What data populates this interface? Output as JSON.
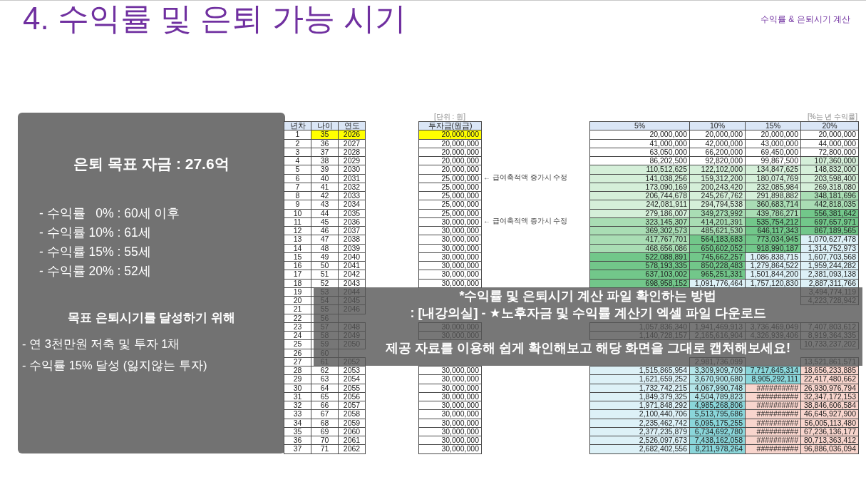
{
  "header": {
    "title": "4. 수익률 및 은퇴 가능 시기",
    "section": "수익률 & 은퇴시기 계산"
  },
  "summary": {
    "heading": "은퇴 목표 자금 : 27.6억",
    "results": [
      "- 수익률   0% : 60세 이후",
      "- 수익률 10% : 61세",
      "- 수익률 15% : 55세",
      "- 수익률 20% : 52세"
    ],
    "plan_heading": "목표 은퇴시기를 달성하기 위해",
    "plan": [
      "- 연 3천만원 저축 및 투자 1채",
      "- 수익률 15% 달성 (잃지않는 투자)"
    ]
  },
  "sheet": {
    "unit_note": "[단위 : 원]",
    "rate_note": "[%는 년 수익률]",
    "columns": [
      "년차",
      "나이",
      "연도"
    ],
    "invest_column": "투자금(원금)",
    "rate_columns": [
      "5%",
      "10%",
      "15%",
      "20%"
    ],
    "rows": [
      {
        "cells": [
          "1",
          "35",
          "2026"
        ],
        "invest": "20,000,000",
        "highlighted": true
      },
      {
        "cells": [
          "2",
          "36",
          "2027"
        ],
        "invest": "20,000,000",
        "highlighted": false
      },
      {
        "cells": [
          "3",
          "37",
          "2028"
        ],
        "invest": "20,000,000",
        "highlighted": false
      },
      {
        "cells": [
          "4",
          "38",
          "2029"
        ],
        "invest": "20,000,000",
        "highlighted": false
      },
      {
        "cells": [
          "5",
          "39",
          "2030"
        ],
        "invest": "20,000,000",
        "highlighted": false
      },
      {
        "cells": [
          "6",
          "40",
          "2031"
        ],
        "invest": "25,000,000",
        "highlighted": false,
        "note": "← 급여축적액 증가시 수정"
      },
      {
        "cells": [
          "7",
          "41",
          "2032"
        ],
        "invest": "25,000,000",
        "highlighted": false
      },
      {
        "cells": [
          "8",
          "42",
          "2033"
        ],
        "invest": "25,000,000",
        "highlighted": false
      },
      {
        "cells": [
          "9",
          "43",
          "2034"
        ],
        "invest": "25,000,000",
        "highlighted": false
      },
      {
        "cells": [
          "10",
          "44",
          "2035"
        ],
        "invest": "25,000,000",
        "highlighted": false
      },
      {
        "cells": [
          "11",
          "45",
          "2036"
        ],
        "invest": "30,000,000",
        "highlighted": false,
        "note": "← 급여축적액 증가시 수정"
      },
      {
        "cells": [
          "12",
          "46",
          "2037"
        ],
        "invest": "30,000,000",
        "highlighted": false
      },
      {
        "cells": [
          "13",
          "47",
          "2038"
        ],
        "invest": "30,000,000",
        "highlighted": false
      },
      {
        "cells": [
          "14",
          "48",
          "2039"
        ],
        "invest": "30,000,000",
        "highlighted": false
      },
      {
        "cells": [
          "15",
          "49",
          "2040"
        ],
        "invest": "30,000,000",
        "highlighted": false
      },
      {
        "cells": [
          "16",
          "50",
          "2041"
        ],
        "invest": "30,000,000",
        "highlighted": false
      },
      {
        "cells": [
          "17",
          "51",
          "2042"
        ],
        "invest": "30,000,000",
        "highlighted": false
      },
      {
        "cells": [
          "18",
          "52",
          "2043"
        ],
        "invest": "30,000,000",
        "highlighted": false
      },
      {
        "cells": [
          "19",
          "53",
          "2044"
        ],
        "invest": null,
        "highlighted": false
      },
      {
        "cells": [
          "20",
          "54",
          "2045"
        ],
        "invest": null,
        "highlighted": false
      },
      {
        "cells": [
          "21",
          "55",
          "2046"
        ],
        "invest": null,
        "highlighted": false
      },
      {
        "cells": [
          "22",
          "56",
          null
        ],
        "invest": null,
        "highlighted": false
      },
      {
        "cells": [
          "23",
          "57",
          "2048"
        ],
        "invest": "30,000,000",
        "highlighted": false
      },
      {
        "cells": [
          "24",
          "58",
          "2049"
        ],
        "invest": "30,000,000",
        "highlighted": false
      },
      {
        "cells": [
          "25",
          "59",
          "2050"
        ],
        "invest": null,
        "highlighted": false
      },
      {
        "cells": [
          "26",
          "60",
          null
        ],
        "invest": null,
        "highlighted": false
      },
      {
        "cells": [
          "27",
          "61",
          "2052"
        ],
        "invest": null,
        "highlighted": false
      },
      {
        "cells": [
          "28",
          "62",
          "2053"
        ],
        "invest": "30,000,000",
        "highlighted": false
      },
      {
        "cells": [
          "29",
          "63",
          "2054"
        ],
        "invest": "30,000,000",
        "highlighted": false
      },
      {
        "cells": [
          "30",
          "64",
          "2055"
        ],
        "invest": "30,000,000",
        "highlighted": false
      },
      {
        "cells": [
          "31",
          "65",
          "2056"
        ],
        "invest": "30,000,000",
        "highlighted": false
      },
      {
        "cells": [
          "32",
          "66",
          "2057"
        ],
        "invest": "30,000,000",
        "highlighted": false
      },
      {
        "cells": [
          "33",
          "67",
          "2058"
        ],
        "invest": "30,000,000",
        "highlighted": false
      },
      {
        "cells": [
          "34",
          "68",
          "2059"
        ],
        "invest": "30,000,000",
        "highlighted": false
      },
      {
        "cells": [
          "35",
          "69",
          "2060"
        ],
        "invest": "30,000,000",
        "highlighted": false
      },
      {
        "cells": [
          "36",
          "70",
          "2061"
        ],
        "invest": "30,000,000",
        "highlighted": false
      },
      {
        "cells": [
          "37",
          "71",
          "2062"
        ],
        "invest": "30,000,000",
        "highlighted": false
      }
    ],
    "rate_rows": [
      {
        "cells": [
          {
            "value": "20,000,000",
            "color": "#ffffff"
          },
          {
            "value": "20,000,000",
            "color": "#ffffff"
          },
          {
            "value": "20,000,000",
            "color": "#ffffff"
          },
          {
            "value": "20,000,000",
            "color": "#ffffff"
          }
        ]
      },
      {
        "cells": [
          {
            "value": "41,000,000",
            "color": "#ffffff"
          },
          {
            "value": "42,000,000",
            "color": "#ffffff"
          },
          {
            "value": "43,000,000",
            "color": "#ffffff"
          },
          {
            "value": "44,000,000",
            "color": "#ffffff"
          }
        ]
      },
      {
        "cells": [
          {
            "value": "63,050,000",
            "color": "#ffffff"
          },
          {
            "value": "66,200,000",
            "color": "#ffffff"
          },
          {
            "value": "69,450,000",
            "color": "#ffffff"
          },
          {
            "value": "72,800,000",
            "color": "#ffffff"
          }
        ]
      },
      {
        "cells": [
          {
            "value": "86,202,500",
            "color": "#ffffff"
          },
          {
            "value": "92,820,000",
            "color": "#ffffff"
          },
          {
            "value": "99,867,500",
            "color": "#ffffff"
          },
          {
            "value": "107,360,000",
            "color": "#d5efd9"
          }
        ]
      },
      {
        "cells": [
          {
            "value": "110,512,625",
            "color": "#d5efd9"
          },
          {
            "value": "122,102,000",
            "color": "#d5efd9"
          },
          {
            "value": "134,847,625",
            "color": "#d5efd9"
          },
          {
            "value": "148,832,000",
            "color": "#d5efd9"
          }
        ]
      },
      {
        "cells": [
          {
            "value": "141,038,256",
            "color": "#d5efd9"
          },
          {
            "value": "159,312,200",
            "color": "#d5efd9"
          },
          {
            "value": "180,074,769",
            "color": "#d5efd9"
          },
          {
            "value": "203,598,400",
            "color": "#d5efd9"
          }
        ]
      },
      {
        "cells": [
          {
            "value": "173,090,169",
            "color": "#d5efd9"
          },
          {
            "value": "200,243,420",
            "color": "#d5efd9"
          },
          {
            "value": "232,085,984",
            "color": "#d5efd9"
          },
          {
            "value": "269,318,080",
            "color": "#d5efd9"
          }
        ]
      },
      {
        "cells": [
          {
            "value": "206,744,678",
            "color": "#d5efd9"
          },
          {
            "value": "245,267,762",
            "color": "#d5efd9"
          },
          {
            "value": "291,898,882",
            "color": "#d5efd9"
          },
          {
            "value": "348,181,696",
            "color": "#a9ddb4"
          }
        ]
      },
      {
        "cells": [
          {
            "value": "242,081,911",
            "color": "#d5efd9"
          },
          {
            "value": "294,794,538",
            "color": "#d5efd9"
          },
          {
            "value": "360,683,714",
            "color": "#a9ddb4"
          },
          {
            "value": "442,818,035",
            "color": "#a9ddb4"
          }
        ]
      },
      {
        "cells": [
          {
            "value": "279,186,007",
            "color": "#d5efd9"
          },
          {
            "value": "349,273,992",
            "color": "#a9ddb4"
          },
          {
            "value": "439,786,271",
            "color": "#a9ddb4"
          },
          {
            "value": "556,381,642",
            "color": "#72c78a"
          }
        ]
      },
      {
        "cells": [
          {
            "value": "323,145,307",
            "color": "#a9ddb4"
          },
          {
            "value": "414,201,391",
            "color": "#a9ddb4"
          },
          {
            "value": "535,754,212",
            "color": "#72c78a"
          },
          {
            "value": "697,657,971",
            "color": "#72c78a"
          }
        ]
      },
      {
        "cells": [
          {
            "value": "369,302,573",
            "color": "#a9ddb4"
          },
          {
            "value": "485,621,530",
            "color": "#a9ddb4"
          },
          {
            "value": "646,117,343",
            "color": "#72c78a"
          },
          {
            "value": "867,189,565",
            "color": "#72c78a"
          }
        ]
      },
      {
        "cells": [
          {
            "value": "417,767,701",
            "color": "#a9ddb4"
          },
          {
            "value": "564,183,683",
            "color": "#72c78a"
          },
          {
            "value": "773,034,945",
            "color": "#72c78a"
          },
          {
            "value": "1,070,627,478",
            "color": "#ddf1f7"
          }
        ]
      },
      {
        "cells": [
          {
            "value": "468,656,086",
            "color": "#a9ddb4"
          },
          {
            "value": "650,602,052",
            "color": "#72c78a"
          },
          {
            "value": "918,990,187",
            "color": "#72c78a"
          },
          {
            "value": "1,314,752,973",
            "color": "#ddf1f7"
          }
        ]
      },
      {
        "cells": [
          {
            "value": "522,088,891",
            "color": "#72c78a"
          },
          {
            "value": "745,662,257",
            "color": "#72c78a"
          },
          {
            "value": "1,086,838,715",
            "color": "#ddf1f7"
          },
          {
            "value": "1,607,703,568",
            "color": "#ddf1f7"
          }
        ]
      },
      {
        "cells": [
          {
            "value": "578,193,335",
            "color": "#72c78a"
          },
          {
            "value": "850,228,483",
            "color": "#72c78a"
          },
          {
            "value": "1,279,864,522",
            "color": "#ddf1f7"
          },
          {
            "value": "1,959,244,282",
            "color": "#ddf1f7"
          }
        ]
      },
      {
        "cells": [
          {
            "value": "637,103,002",
            "color": "#72c78a"
          },
          {
            "value": "965,251,331",
            "color": "#72c78a"
          },
          {
            "value": "1,501,844,200",
            "color": "#ddf1f7"
          },
          {
            "value": "2,381,093,138",
            "color": "#ddf1f7"
          }
        ]
      },
      {
        "cells": [
          {
            "value": "698,958,152",
            "color": "#72c78a"
          },
          {
            "value": "1,091,776,464",
            "color": "#ddf1f7"
          },
          {
            "value": "1,757,120,830",
            "color": "#ddf1f7"
          },
          {
            "value": "2,887,311,766",
            "color": "#ddf1f7"
          }
        ]
      },
      {
        "cells": [
          {},
          {},
          {},
          {
            "value": "3,494,774,119"
          }
        ]
      },
      {
        "cells": [
          {},
          {},
          {},
          {
            "value": "4,223,728,942"
          }
        ]
      },
      {
        "cells": [
          {},
          {},
          {},
          {}
        ]
      },
      {
        "cells": [
          {},
          {},
          {},
          {}
        ]
      },
      {
        "cells": [
          {
            "value": "1,057,836,340"
          },
          {
            "value": "1,941,469,913"
          },
          {
            "value": "3,736,469,049"
          },
          {
            "value": "7,407,803,612"
          }
        ]
      },
      {
        "cells": [
          {
            "value": "1,140,728,157"
          },
          {
            "value": "2,165,616,904"
          },
          {
            "value": "4,326,939,406"
          },
          {
            "value": "8,919,364,335"
          }
        ]
      },
      {
        "cells": [
          {},
          {},
          {},
          {
            "value": "10,733,237,202"
          }
        ]
      },
      {
        "cells": [
          {},
          {},
          {},
          {}
        ]
      },
      {
        "cells": [
          {},
          {
            "value": "2,981,736,099"
          },
          {},
          {
            "value": "13,521,861,571"
          }
        ]
      },
      {
        "cells": [
          {
            "value": "1,515,865,954",
            "color": "#ddf1f7"
          },
          {
            "value": "3,309,909,709",
            "color": "#b4e6ea"
          },
          {
            "value": "7,717,645,314",
            "color": "#8ad6da"
          },
          {
            "value": "18,656,233,885",
            "color": "#f8d5cd"
          }
        ]
      },
      {
        "cells": [
          {
            "value": "1,621,659,252",
            "color": "#ddf1f7"
          },
          {
            "value": "3,670,900,680",
            "color": "#b4e6ea"
          },
          {
            "value": "8,905,292,111",
            "color": "#8ad6da"
          },
          {
            "value": "22,417,480,662",
            "color": "#f8d5cd"
          }
        ]
      },
      {
        "cells": [
          {
            "value": "1,732,742,215",
            "color": "#ddf1f7"
          },
          {
            "value": "4,067,990,748",
            "color": "#b4e6ea"
          },
          {
            "value": "##########",
            "color": "#f8d5cd"
          },
          {
            "value": "26,930,976,794",
            "color": "#f8d5cd"
          }
        ]
      },
      {
        "cells": [
          {
            "value": "1,849,379,325",
            "color": "#ddf1f7"
          },
          {
            "value": "4,504,789,823",
            "color": "#b4e6ea"
          },
          {
            "value": "##########",
            "color": "#f8d5cd"
          },
          {
            "value": "32,347,172,153",
            "color": "#f8d5cd"
          }
        ]
      },
      {
        "cells": [
          {
            "value": "1,971,848,292",
            "color": "#ddf1f7"
          },
          {
            "value": "4,985,268,806",
            "color": "#8ad6da"
          },
          {
            "value": "##########",
            "color": "#f8d5cd"
          },
          {
            "value": "38,846,606,584",
            "color": "#f8d5cd"
          }
        ]
      },
      {
        "cells": [
          {
            "value": "2,100,440,706",
            "color": "#ddf1f7"
          },
          {
            "value": "5,513,795,686",
            "color": "#8ad6da"
          },
          {
            "value": "##########",
            "color": "#f8d5cd"
          },
          {
            "value": "46,645,927,900",
            "color": "#f8d5cd"
          }
        ]
      },
      {
        "cells": [
          {
            "value": "2,235,462,742",
            "color": "#ddf1f7"
          },
          {
            "value": "6,095,175,255",
            "color": "#8ad6da"
          },
          {
            "value": "##########",
            "color": "#f8d5cd"
          },
          {
            "value": "56,005,113,480",
            "color": "#f8d5cd"
          }
        ]
      },
      {
        "cells": [
          {
            "value": "2,377,235,879",
            "color": "#ddf1f7"
          },
          {
            "value": "6,734,692,780",
            "color": "#8ad6da"
          },
          {
            "value": "##########",
            "color": "#f8d5cd"
          },
          {
            "value": "67,236,136,177",
            "color": "#f8d5cd"
          }
        ]
      },
      {
        "cells": [
          {
            "value": "2,526,097,673",
            "color": "#ddf1f7"
          },
          {
            "value": "7,438,162,058",
            "color": "#8ad6da"
          },
          {
            "value": "##########",
            "color": "#f8d5cd"
          },
          {
            "value": "80,713,363,412",
            "color": "#f8d5cd"
          }
        ]
      },
      {
        "cells": [
          {
            "value": "2,682,402,556",
            "color": "#ddf1f7"
          },
          {
            "value": "8,211,978,264",
            "color": "#8ad6da"
          },
          {
            "value": "##########",
            "color": "#f8d5cd"
          },
          {
            "value": "96,886,036,094",
            "color": "#f8d5cd"
          }
        ]
      }
    ]
  },
  "notice": {
    "lines": [
      "*수익률 및 은퇴시기 계산 파일 확인하는 방법",
      ": [내강의실] - ★노후자금 및 수익률 계산기 엑셀 파일 다운로드",
      "제공 자료를 이용해 쉽게 확인해보고 해당 화면을 그대로 캡처해보세요!"
    ]
  }
}
